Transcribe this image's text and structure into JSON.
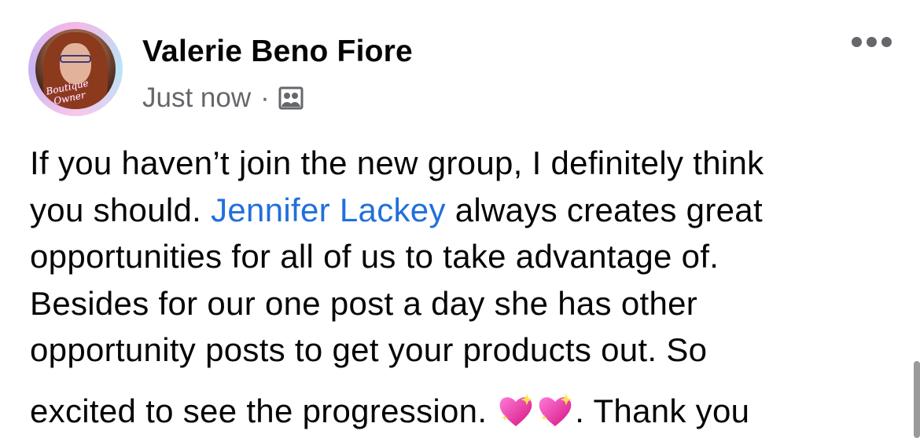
{
  "post": {
    "author_name": "Valerie Beno Fiore",
    "timestamp": "Just now",
    "separator": "·",
    "audience_icon": "group-audience-icon",
    "more_icon": "more-options-icon",
    "avatar_caption": "Boutique Owner",
    "body": {
      "line1": "If you haven’t join the new group, I definitely think",
      "line2_before": "you should. ",
      "mention": "Jennifer Lackey",
      "line2_after": " always creates great",
      "line3": "opportunities for all of us to take advantage of.",
      "line4": "Besides for our one post a day she has other",
      "line5": "opportunity posts to get your products out. So",
      "line6_before": "excited to see the progression. ",
      "line6_after": ". Thank you",
      "emoji_icon": "sparkling-heart-icon"
    }
  },
  "colors": {
    "mention": "#216fdb",
    "meta": "#65676b",
    "text": "#050505"
  }
}
